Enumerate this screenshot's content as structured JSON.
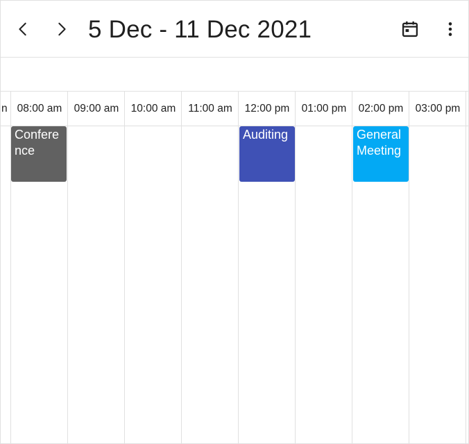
{
  "header": {
    "title": "5 Dec - 11 Dec 2021",
    "prev_icon": "chevron-left-icon",
    "next_icon": "chevron-right-icon",
    "today_icon": "calendar-today-icon",
    "more_icon": "more-vertical-icon"
  },
  "time_slots": {
    "partial": "n",
    "labels": [
      "08:00 am",
      "09:00 am",
      "10:00 am",
      "11:00 am",
      "12:00 pm",
      "01:00 pm",
      "02:00 pm",
      "03:00 pm"
    ]
  },
  "appointments": [
    {
      "subject": "Conference",
      "color": "#616161"
    },
    {
      "subject": "Auditing",
      "color": "#3f51b5"
    },
    {
      "subject": "General Meeting",
      "color": "#03a9f4"
    }
  ]
}
